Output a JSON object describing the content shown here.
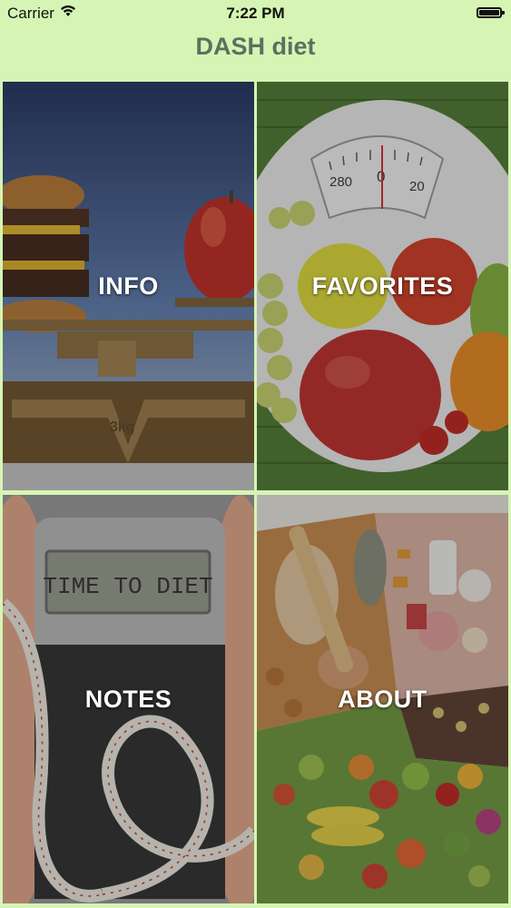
{
  "status_bar": {
    "carrier": "Carrier",
    "time": "7:22 PM",
    "wifi_icon": "wifi-icon",
    "battery_icon": "battery-icon"
  },
  "nav": {
    "title": "DASH diet"
  },
  "tiles": [
    {
      "label": "INFO",
      "image": "burger-vs-apple-on-scale"
    },
    {
      "label": "FAVORITES",
      "image": "fruit-plate-with-scale-dial"
    },
    {
      "label": "NOTES",
      "image": "bathroom-scale-time-to-diet"
    },
    {
      "label": "ABOUT",
      "image": "assorted-food-groups"
    }
  ],
  "image_text": {
    "scale_dial_left": "280",
    "scale_dial_center": "0",
    "scale_dial_right": "20",
    "scale_weight": "3kg",
    "bathroom_scale_display": "TIME TO DIET"
  },
  "colors": {
    "background": "#D6F5B4",
    "title": "#5C7060",
    "label": "#FFFFFF"
  }
}
